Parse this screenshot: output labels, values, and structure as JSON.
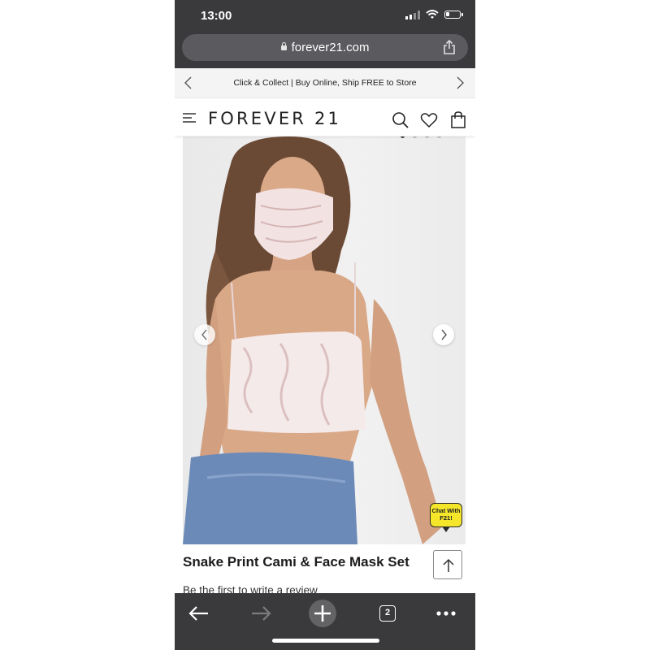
{
  "status": {
    "time": "13:00"
  },
  "browser": {
    "url": "forever21.com",
    "open_tabs": "2"
  },
  "promo": {
    "text": "Click & Collect | Buy Online, Ship FREE to Store"
  },
  "header": {
    "logo": "FOREVER 21"
  },
  "product": {
    "title": "Snake Print Cami & Face Mask Set",
    "review_prompt": "Be the first to write a review",
    "image_dots_active": 1,
    "image_dots_total": 4
  },
  "chat": {
    "label_line1": "Chat With",
    "label_line2": "F21!"
  },
  "colors": {
    "chrome": "#3a3a3c",
    "accent_yellow": "#f5e62a"
  }
}
